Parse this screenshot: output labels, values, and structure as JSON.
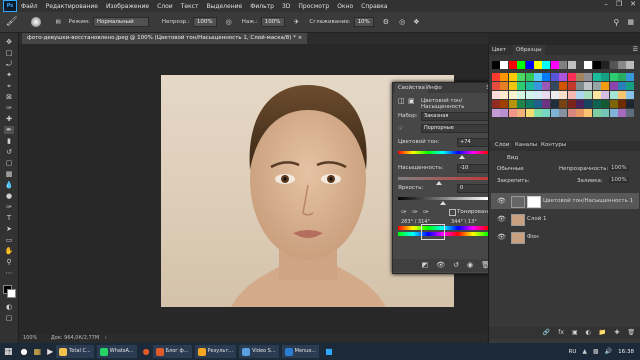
{
  "menu": [
    "Файл",
    "Редактирование",
    "Изображение",
    "Слои",
    "Текст",
    "Выделение",
    "Фильтр",
    "3D",
    "Просмотр",
    "Окно",
    "Справка"
  ],
  "options": {
    "mode_label": "Режим:",
    "mode_value": "Нормальный",
    "opacity_label": "Непрозр.:",
    "opacity_value": "100%",
    "pressure_label": "Наж.:",
    "pressure_value": "100%",
    "smooth_label": "Сглаживание:",
    "smooth_value": "10%"
  },
  "doc_tab": "фото-девушки-восстановлено.jpeg @ 100% (Цветовой тон/Насыщенность 1, Слой-маска/8) *",
  "status": {
    "zoom": "100%",
    "doc": "Док: 964,0К/2,77М"
  },
  "properties": {
    "tab1": "Свойства",
    "tab2": "Инфо",
    "title": "Цветовой тон/Насыщенность",
    "preset_label": "Набор:",
    "preset_value": "Заказная",
    "channel_value": "Порпорные",
    "hue_label": "Цветовой тон:",
    "hue_value": "+74",
    "sat_label": "Насыщенность:",
    "sat_value": "-10",
    "light_label": "Яркость:",
    "light_value": "0",
    "colorize_label": "Тонирование",
    "range_left": "283° / 314°",
    "range_right": "344° \\ 13°"
  },
  "swatches": {
    "tab1": "Цвет",
    "tab2": "Образцы"
  },
  "layers_tabs": [
    "Слои",
    "Каналы",
    "Контуры"
  ],
  "layers": {
    "kind_label": "Вид",
    "blend": "Обычные",
    "opacity_label": "Непрозрачность:",
    "opacity_value": "100%",
    "lock_label": "Закрепить:",
    "fill_label": "Заливка:",
    "fill_value": "100%",
    "items": [
      {
        "name": "Цветовой тон/Насыщенность 1"
      },
      {
        "name": "Слой 1"
      },
      {
        "name": "Фон"
      }
    ]
  },
  "taskbar": {
    "items": [
      {
        "label": "Total C...",
        "color": "#f2c14e"
      },
      {
        "label": "WhatsA...",
        "color": "#25d366"
      },
      {
        "label": "Блог ф...",
        "color": "#e05a2a"
      },
      {
        "label": "Результ...",
        "color": "#f5a623"
      },
      {
        "label": "Video S...",
        "color": "#5aa0e0"
      },
      {
        "label": "Menuo...",
        "color": "#2a7fd4"
      }
    ],
    "lang": "RU",
    "time": "16:38"
  },
  "colors": {
    "accent": "#31a8ff",
    "fg": "#000000",
    "bg": "#ffffff"
  }
}
